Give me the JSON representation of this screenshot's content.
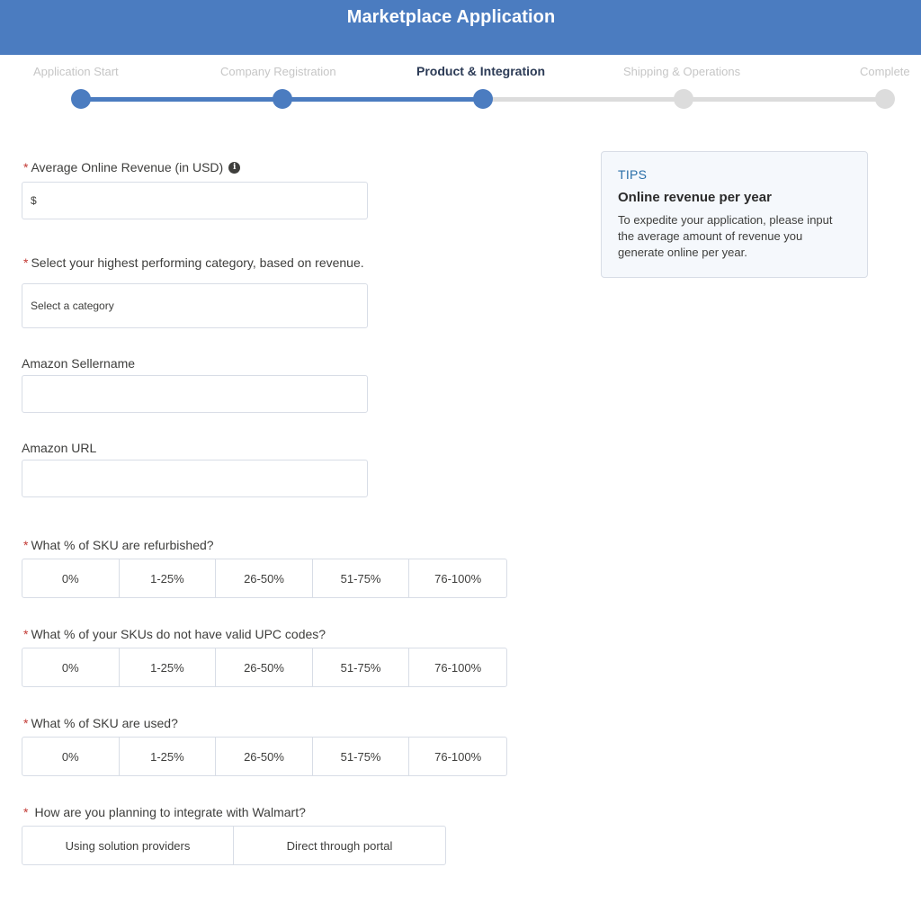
{
  "header": {
    "title": "Marketplace Application"
  },
  "progress": {
    "steps": [
      {
        "label": "Application Start",
        "state": "done"
      },
      {
        "label": "Company Registration",
        "state": "done"
      },
      {
        "label": "Product & Integration",
        "state": "current"
      },
      {
        "label": "Shipping & Operations",
        "state": "todo"
      },
      {
        "label": "Complete",
        "state": "todo"
      }
    ],
    "completed_fraction": 0.5
  },
  "form": {
    "required_mark": "*",
    "revenue": {
      "label": "Average Online Revenue (in USD)",
      "info_icon": "info-icon",
      "value": "$"
    },
    "category": {
      "label": "Select your highest performing category, based on revenue.",
      "value": "Select a category"
    },
    "seller": {
      "label": "Amazon Sellername",
      "value": ""
    },
    "url": {
      "label": "Amazon URL",
      "value": ""
    },
    "refurbished": {
      "label": "What % of SKU are refurbished?",
      "options": [
        "0%",
        "1-25%",
        "26-50%",
        "51-75%",
        "76-100%"
      ]
    },
    "upc": {
      "label": "What % of your SKUs do not have valid UPC codes?",
      "options": [
        "0%",
        "1-25%",
        "26-50%",
        "51-75%",
        "76-100%"
      ]
    },
    "used": {
      "label": "What % of SKU are used?",
      "options": [
        "0%",
        "1-25%",
        "26-50%",
        "51-75%",
        "76-100%"
      ]
    },
    "integration": {
      "label": "How are you planning to integrate with Walmart?",
      "options": [
        "Using solution providers",
        "Direct through portal"
      ]
    }
  },
  "tips": {
    "kicker": "TIPS",
    "heading": "Online revenue per year",
    "body": "To expedite your application, please input the average amount of revenue you generate online per year."
  },
  "colors": {
    "brand": "#4b7cc0",
    "required": "#c23934",
    "track": "#dcdcdc"
  }
}
